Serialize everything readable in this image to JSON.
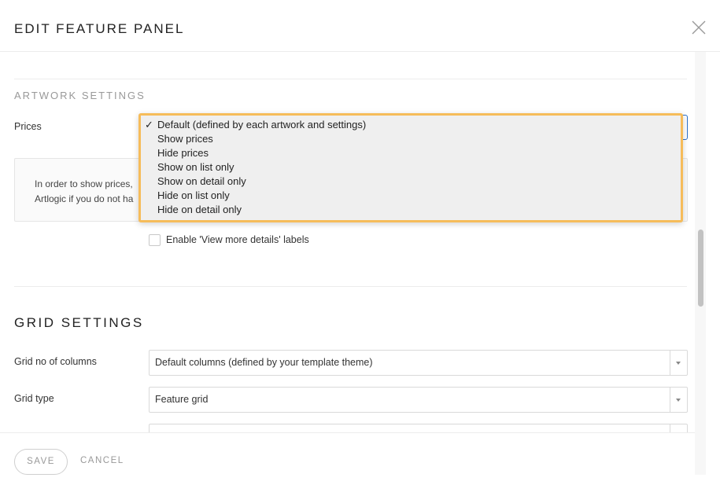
{
  "header": {
    "title": "EDIT FEATURE PANEL",
    "close_icon": "close-icon"
  },
  "artwork_settings": {
    "label": "ARTWORK SETTINGS",
    "prices": {
      "label": "Prices",
      "selected": "Default (defined by each artwork and settings)",
      "options": [
        "Default (defined by each artwork and settings)",
        "Show prices",
        "Hide prices",
        "Show on list only",
        "Show on detail only",
        "Hide on list only",
        "Hide on detail only"
      ],
      "checkmark": "✓"
    },
    "notice": {
      "line1": "In order to show prices,",
      "line2": "Artlogic if you do not ha"
    },
    "view_more": {
      "label": "Enable 'View more details' labels",
      "checked": false
    }
  },
  "grid_settings": {
    "heading": "GRID SETTINGS",
    "columns": {
      "label": "Grid no of columns",
      "value": "Default columns (defined by your template theme)"
    },
    "type": {
      "label": "Grid type",
      "value": "Feature grid"
    }
  },
  "footer": {
    "save_label": "SAVE",
    "cancel_label": "CANCEL"
  },
  "colors": {
    "dropdown_highlight": "#f6bc5a",
    "focus_border": "#2a6fc9",
    "dropdown_bg": "#efefef"
  }
}
